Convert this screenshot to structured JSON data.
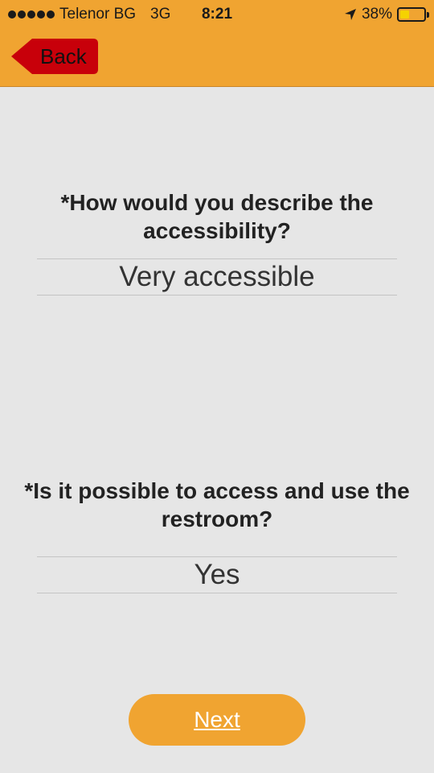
{
  "status_bar": {
    "carrier": "Telenor BG",
    "network": "3G",
    "time": "8:21",
    "battery": "38%",
    "battery_level": 0.38,
    "icons": [
      "signal-dots-icon",
      "location-arrow-icon",
      "battery-icon"
    ]
  },
  "header": {
    "back_label": "Back",
    "colors": {
      "bar": "#f0a431",
      "back_button": "#c8000a"
    }
  },
  "form": {
    "questions": [
      {
        "label": "*How would you describe the accessibility?",
        "answer": "Very accessible"
      },
      {
        "label": "*Is it possible to access and use the restroom?",
        "answer": "Yes"
      }
    ],
    "next_label": "Next"
  },
  "colors": {
    "background": "#e6e6e6",
    "accent": "#f0a431"
  }
}
